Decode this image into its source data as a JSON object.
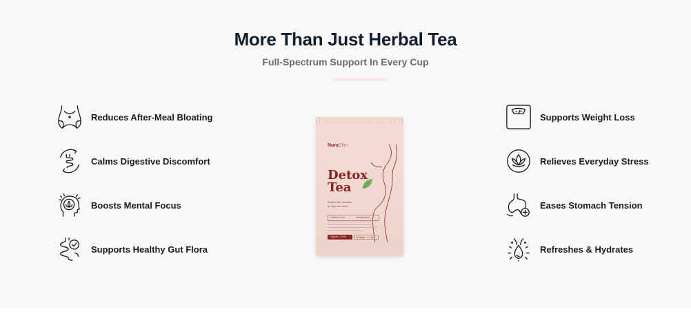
{
  "header": {
    "title": "More Than Just Herbal Tea",
    "subtitle": "Full-Spectrum Support In Every Cup"
  },
  "features_left": [
    {
      "label": "Reduces After-Meal Bloating",
      "icon": "belly-icon"
    },
    {
      "label": "Calms Digestive Discomfort",
      "icon": "intestine-cycle-icon"
    },
    {
      "label": "Boosts Mental Focus",
      "icon": "head-lotus-icon"
    },
    {
      "label": "Supports Healthy Gut Flora",
      "icon": "gut-check-icon"
    }
  ],
  "features_right": [
    {
      "label": "Supports Weight Loss",
      "icon": "scale-icon"
    },
    {
      "label": "Relieves Everyday Stress",
      "icon": "lotus-circle-icon"
    },
    {
      "label": "Eases Stomach Tension",
      "icon": "stomach-plus-icon"
    },
    {
      "label": "Refreshes & Hydrates",
      "icon": "water-drop-icon"
    }
  ],
  "product": {
    "brand_a": "Nura",
    "brand_b": "Slim",
    "title_line1": "Detox",
    "title_line2": "Tea",
    "tagline_line1": "Soothe the stomach",
    "tagline_line2": "& calm the mind",
    "tag1": "Caffeine-Free",
    "tag2": "Herbal Blend",
    "footer_left": "Organic 100%",
    "footer_right": "20 Bags · 1.13g"
  },
  "colors": {
    "section_bg": "#f8f8f9",
    "title": "#13202b",
    "accent": "#8b2424",
    "divider": "#fbe9e9"
  }
}
